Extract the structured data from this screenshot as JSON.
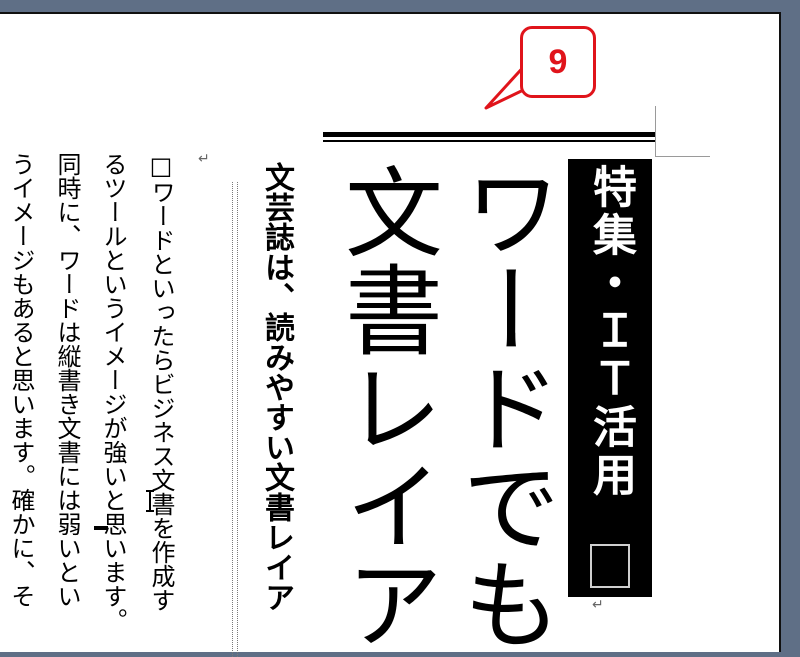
{
  "document": {
    "heading_label": "特集・ＩＴ活用",
    "title_line1": "ワードでも",
    "title_line2": "文書レイア",
    "subtitle": "文芸誌は、読みやすい文書レイア",
    "body_lines": [
      "□ワードといったらビジネス文書を作成す",
      "るツールというイメージが強いと思います。",
      "同時に、ワードは縦書き文書には弱いとい",
      "うイメージもあると思います。確かに、そ"
    ],
    "paragraph_mark": "↵"
  },
  "callout": {
    "number": "9",
    "color": "#e0141b"
  },
  "colors": {
    "background": "#5f6f86",
    "page": "#ffffff",
    "heading_block": "#000000"
  }
}
